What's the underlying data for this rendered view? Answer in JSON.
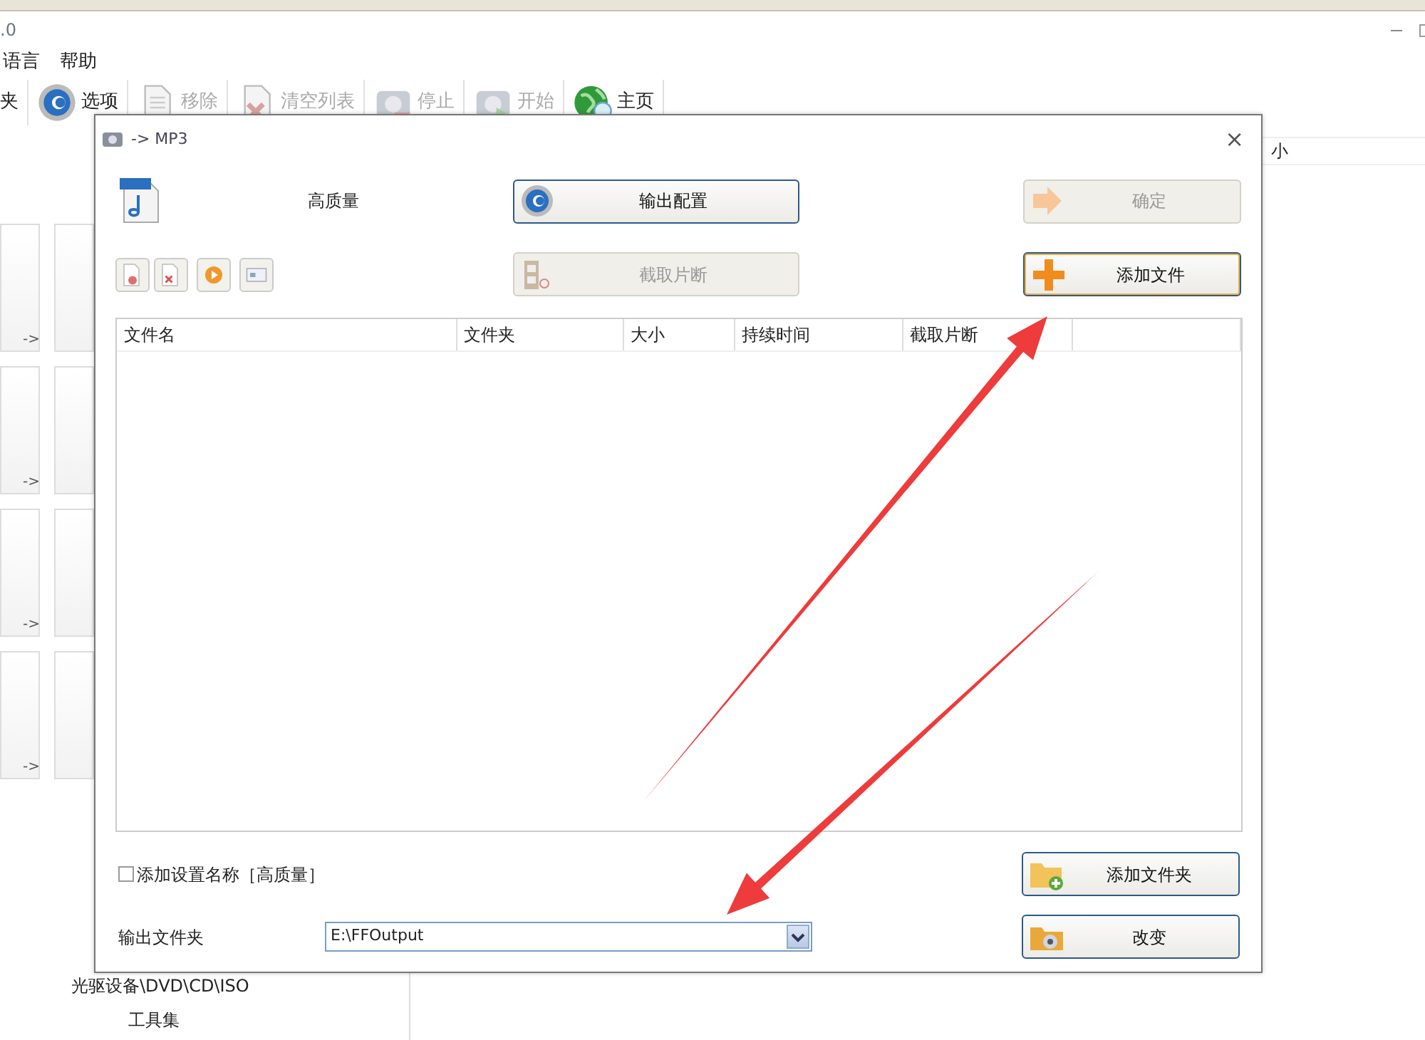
{
  "app": {
    "title": ".0",
    "menu": [
      "语言",
      "帮助"
    ],
    "toolbar": [
      {
        "label": "夹",
        "kind": "none",
        "disabled": false
      },
      {
        "label": "选项",
        "kind": "gear",
        "disabled": false
      },
      {
        "label": "移除",
        "kind": "doc",
        "disabled": true
      },
      {
        "label": "清空列表",
        "kind": "docx",
        "disabled": true
      },
      {
        "label": "停止",
        "kind": "stop",
        "disabled": true
      },
      {
        "label": "开始",
        "kind": "start",
        "disabled": true
      },
      {
        "label": "主页",
        "kind": "globe",
        "disabled": false
      }
    ],
    "tiles": [
      "->",
      "->",
      "->",
      "->"
    ],
    "panel_items": [
      "光驱设备\\DVD\\CD\\ISO",
      "工具集"
    ],
    "list_header": "小"
  },
  "dialog": {
    "title": "-> MP3",
    "close": "×",
    "profile": "高质量",
    "buttons": {
      "config": {
        "label": "输出配置",
        "disabled": false
      },
      "ok": {
        "label": "确定",
        "disabled": true
      },
      "clip": {
        "label": "截取片断",
        "disabled": true
      },
      "add_file": {
        "label": "添加文件",
        "disabled": false,
        "focused": true
      },
      "add_folder": {
        "label": "添加文件夹",
        "disabled": false
      },
      "change": {
        "label": "改变",
        "disabled": false
      }
    },
    "table": {
      "columns": [
        "文件名",
        "文件夹",
        "大小",
        "持续时间",
        "截取片断"
      ]
    },
    "add_name": {
      "label": "添加设置名称［高质量］",
      "checked": false
    },
    "output": {
      "label": "输出文件夹",
      "value": "E:\\FFOutput"
    }
  }
}
